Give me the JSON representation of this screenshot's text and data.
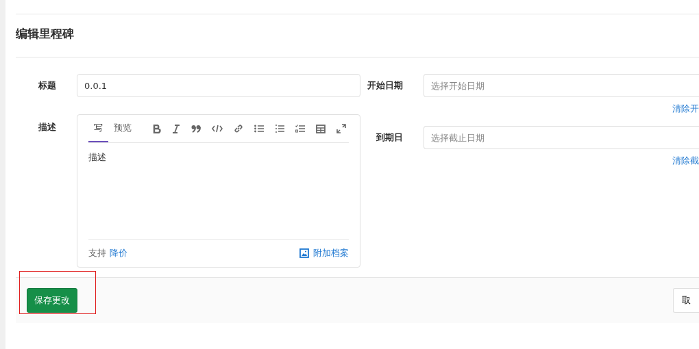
{
  "page_title": "编辑里程碑",
  "form": {
    "title": {
      "label": "标题",
      "value": "0.0.1"
    },
    "description": {
      "label": "描述",
      "tabs": [
        {
          "label": "写",
          "selected": true
        },
        {
          "label": "预览",
          "selected": false
        }
      ],
      "toolbar": [
        {
          "kind": "bold"
        },
        {
          "kind": "italic"
        },
        {
          "kind": "quote"
        },
        {
          "kind": "code"
        },
        {
          "kind": "link"
        },
        {
          "kind": "bullets"
        },
        {
          "kind": "numbers"
        },
        {
          "kind": "tasks"
        },
        {
          "kind": "table"
        },
        {
          "kind": "fullscreen"
        }
      ],
      "value": "描述",
      "support_text": "支持",
      "support_link": "降价",
      "attach_label": "附加档案"
    },
    "start_date": {
      "label": "开始日期",
      "placeholder": "选择开始日期",
      "clear_link": "清除开"
    },
    "due_date": {
      "label": "到期日",
      "placeholder": "选择截止日期",
      "clear_link": "清除截"
    }
  },
  "actions": {
    "save": "保存更改",
    "cancel": "取",
    "save_highlighted": true
  }
}
